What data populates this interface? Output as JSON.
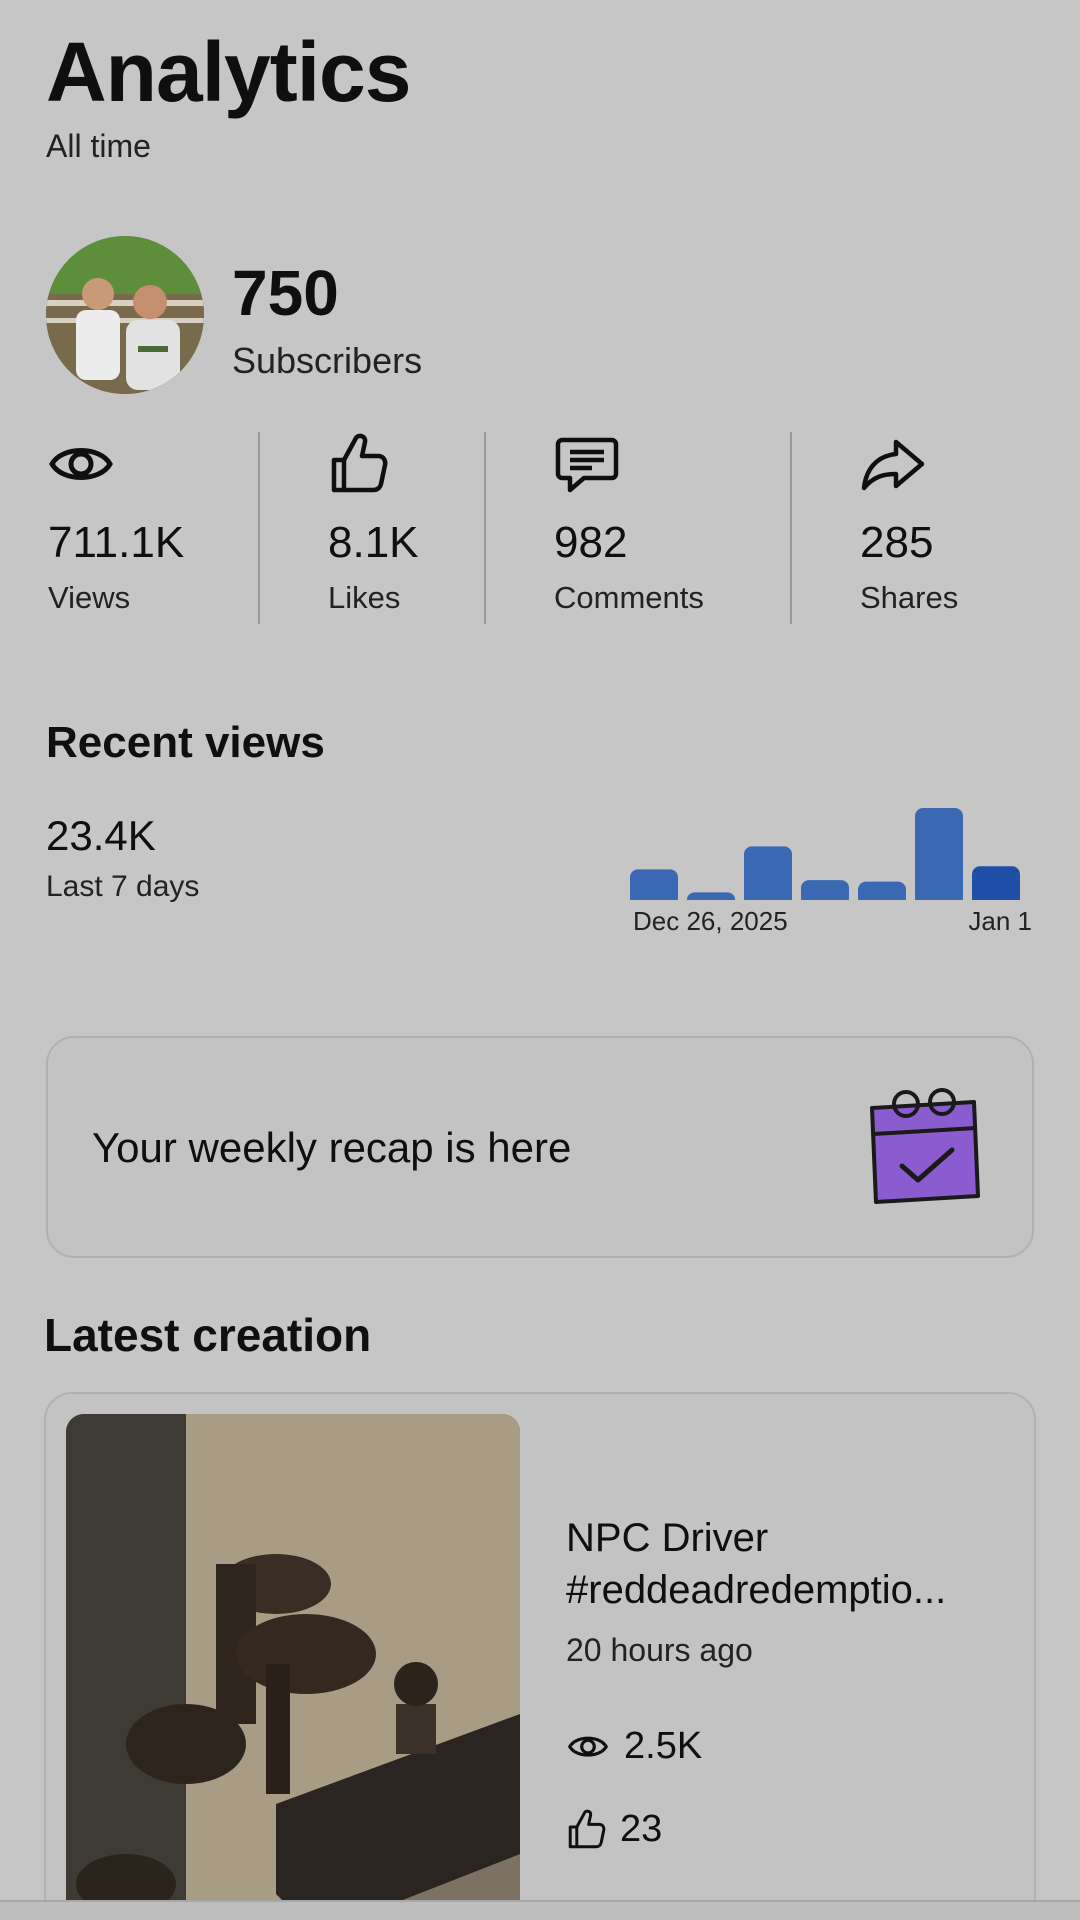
{
  "header": {
    "title": "Analytics",
    "subtitle": "All time"
  },
  "channel": {
    "subscribers_value": "750",
    "subscribers_label": "Subscribers"
  },
  "stats": [
    {
      "icon": "eye-icon",
      "value": "711.1K",
      "label": "Views"
    },
    {
      "icon": "thumbs-up-icon",
      "value": "8.1K",
      "label": "Likes"
    },
    {
      "icon": "comment-icon",
      "value": "982",
      "label": "Comments"
    },
    {
      "icon": "share-icon",
      "value": "285",
      "label": "Shares"
    }
  ],
  "recent_views": {
    "title": "Recent views",
    "value": "23.4K",
    "period": "Last 7 days",
    "x_start": "Dec 26, 2025",
    "x_end": "Jan 1"
  },
  "chart_data": {
    "type": "bar",
    "title": "",
    "xlabel": "",
    "ylabel": "",
    "x_tick_labels": [
      "Dec 26, 2025",
      "Jan 1"
    ],
    "values": [
      2.0,
      0.5,
      3.5,
      1.3,
      1.2,
      6.0,
      2.2
    ],
    "colors": [
      "#3a68b3",
      "#3a68b3",
      "#3a68b3",
      "#3a68b3",
      "#3a68b3",
      "#3a68b3",
      "#1f4fa6"
    ],
    "grid": false
  },
  "recap": {
    "text": "Your weekly recap is here",
    "icon": "calendar-check-icon",
    "icon_color": "#8a5cd0"
  },
  "latest": {
    "title": "Latest creation",
    "video_title_line1": "NPC Driver",
    "video_title_line2": "#reddeadredemptio...",
    "published": "20 hours ago",
    "views": "2.5K",
    "likes": "23"
  }
}
